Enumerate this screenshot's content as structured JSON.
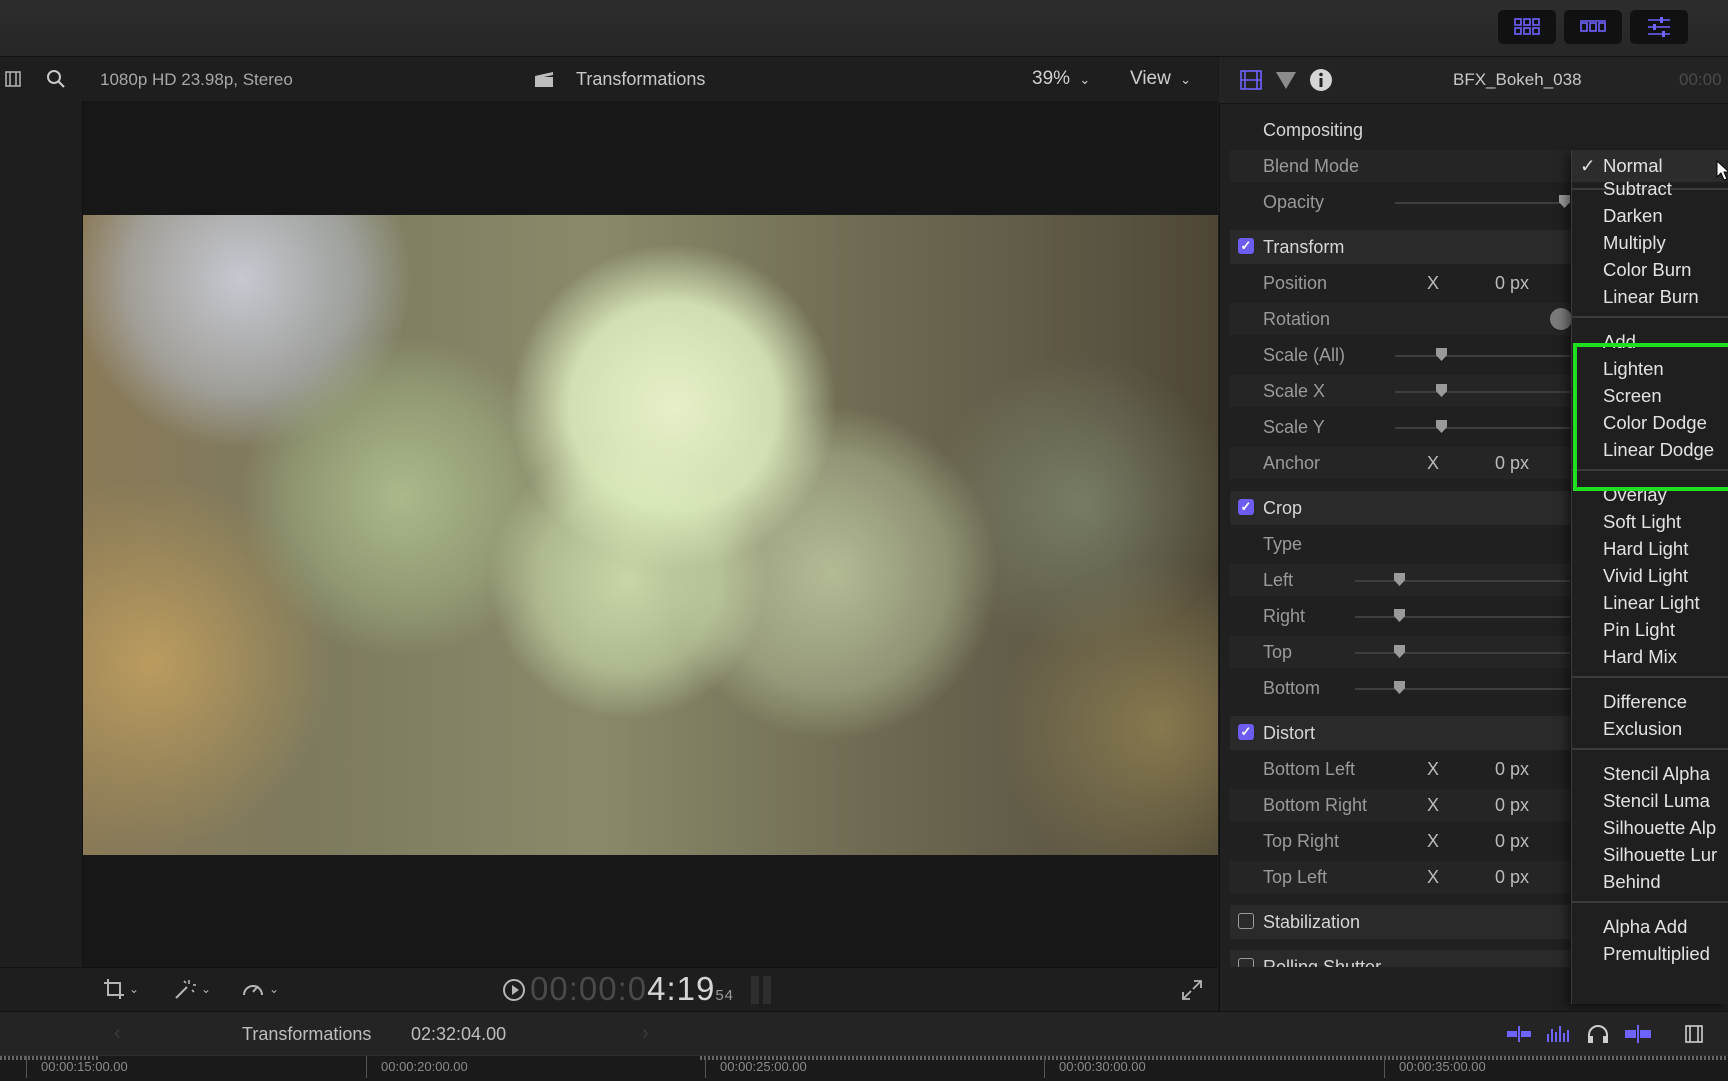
{
  "viewer": {
    "format": "1080p HD 23.98p, Stereo",
    "title": "Transformations",
    "zoom": "39%",
    "view_label": "View",
    "timecode_dim": "00:00:0",
    "timecode_main": "4:19",
    "timecode_frames": "54"
  },
  "inspector": {
    "clip_name": "BFX_Bokeh_038",
    "clip_time": "00:00",
    "compositing": {
      "title": "Compositing",
      "blend_mode_label": "Blend Mode",
      "opacity_label": "Opacity"
    },
    "transform": {
      "title": "Transform",
      "checked": true,
      "position_label": "Position",
      "position_axis": "X",
      "position_value": "0 px",
      "rotation_label": "Rotation",
      "scale_all_label": "Scale (All)",
      "scale_x_label": "Scale X",
      "scale_y_label": "Scale Y",
      "anchor_label": "Anchor",
      "anchor_axis": "X",
      "anchor_value": "0 px"
    },
    "crop": {
      "title": "Crop",
      "checked": true,
      "type_label": "Type",
      "left_label": "Left",
      "right_label": "Right",
      "top_label": "Top",
      "bottom_label": "Bottom"
    },
    "distort": {
      "title": "Distort",
      "checked": true,
      "rows": [
        {
          "label": "Bottom Left",
          "axis": "X",
          "value": "0 px"
        },
        {
          "label": "Bottom Right",
          "axis": "X",
          "value": "0 px"
        },
        {
          "label": "Top Right",
          "axis": "X",
          "value": "0 px"
        },
        {
          "label": "Top Left",
          "axis": "X",
          "value": "0 px"
        }
      ]
    },
    "stabilization": {
      "title": "Stabilization",
      "checked": false
    },
    "rolling_shutter": {
      "title": "Rolling Shutter",
      "checked": false
    }
  },
  "blend_menu": {
    "selected_check": "✓",
    "selected": "Normal",
    "groups": [
      [
        "Subtract",
        "Darken",
        "Multiply",
        "Color Burn",
        "Linear Burn"
      ],
      [
        "Add",
        "Lighten",
        "Screen",
        "Color Dodge",
        "Linear Dodge"
      ],
      [
        "Overlay",
        "Soft Light",
        "Hard Light",
        "Vivid Light",
        "Linear Light",
        "Pin Light",
        "Hard Mix"
      ],
      [
        "Difference",
        "Exclusion"
      ],
      [
        "Stencil Alpha",
        "Stencil Luma",
        "Silhouette Alp",
        "Silhouette Lur",
        "Behind"
      ],
      [
        "Alpha Add",
        "Premultiplied"
      ]
    ],
    "highlight_color": "#1fe01f"
  },
  "timeline": {
    "project": "Transformations",
    "duration": "02:32:04.00",
    "ruler": [
      "00:00:15:00.00",
      "00:00:20:00.00",
      "00:00:25:00.00",
      "00:00:30:00.00",
      "00:00:35:00.00"
    ]
  },
  "colors": {
    "accent": "#6d5cf0",
    "toolbar_icon": "#6f63ff"
  }
}
